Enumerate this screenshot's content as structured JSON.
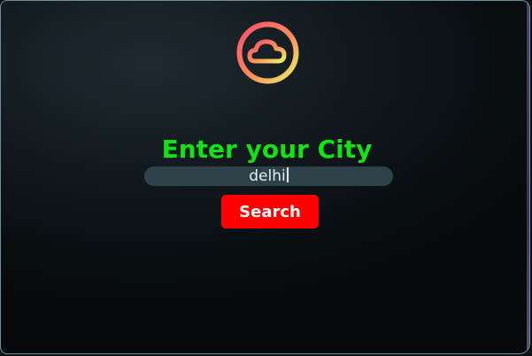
{
  "logo": {
    "icon": "cloud-icon"
  },
  "heading": {
    "text": "Enter your City"
  },
  "search": {
    "value": "delhi",
    "button_label": "Search"
  },
  "colors": {
    "heading": "#13e313",
    "button_bg": "#ff0000",
    "input_bg": "#2e4249",
    "background": "#0b1013"
  }
}
